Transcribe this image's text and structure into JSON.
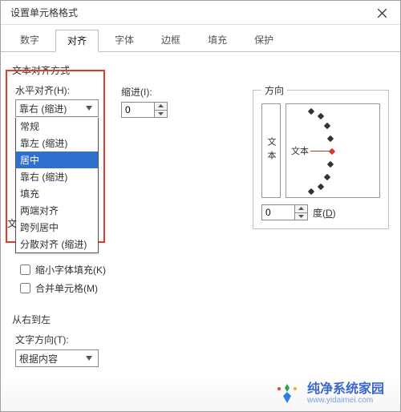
{
  "window": {
    "title": "设置单元格格式",
    "close_label": "关闭"
  },
  "tabs": [
    {
      "label": "数字",
      "active": false
    },
    {
      "label": "对齐",
      "active": true
    },
    {
      "label": "字体",
      "active": false
    },
    {
      "label": "边框",
      "active": false
    },
    {
      "label": "填充",
      "active": false
    },
    {
      "label": "保护",
      "active": false
    }
  ],
  "align": {
    "group_label": "文本对齐方式",
    "horizontal_label": "水平对齐(H):",
    "horizontal_value": "靠右 (缩进)",
    "horizontal_options": [
      {
        "label": "常规",
        "selected": false
      },
      {
        "label": "靠左 (缩进)",
        "selected": false
      },
      {
        "label": "居中",
        "selected": true
      },
      {
        "label": "靠右 (缩进)",
        "selected": false
      },
      {
        "label": "填充",
        "selected": false
      },
      {
        "label": "两端对齐",
        "selected": false
      },
      {
        "label": "跨列居中",
        "selected": false
      },
      {
        "label": "分散对齐 (缩进)",
        "selected": false
      }
    ],
    "indent_label": "缩进(I):",
    "indent_value": "0",
    "vertical_prefix": "文",
    "shrink_label": "缩小字体填充(K)",
    "merge_label": "合并单元格(M)"
  },
  "rtl": {
    "group_label": "从右到左",
    "direction_label": "文字方向(T):",
    "direction_value": "根据内容"
  },
  "orientation": {
    "legend": "方向",
    "vertical_text": "文本",
    "center_text": "文本",
    "degrees_value": "0",
    "degrees_label": "度(D)",
    "degrees_key": "D"
  },
  "colors": {
    "highlight": "#e53b2c",
    "selection": "#2f6fd0"
  },
  "watermark": {
    "title": "纯净系统家园",
    "url": "www.yidaimei.com"
  }
}
